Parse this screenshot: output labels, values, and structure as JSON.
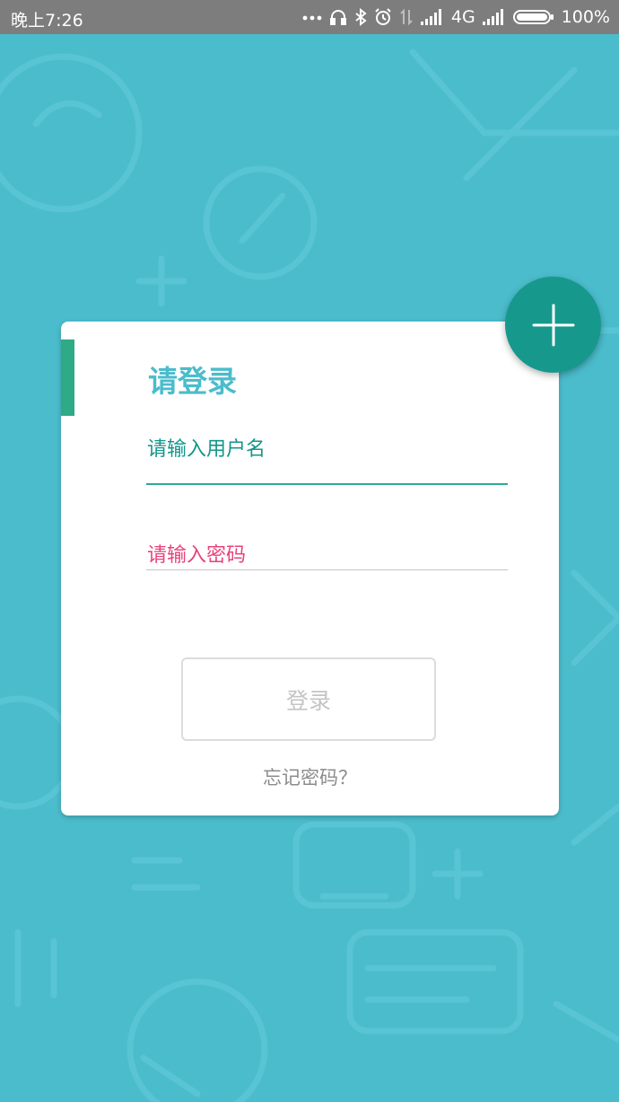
{
  "status_bar": {
    "time": "晚上7:26",
    "network": "4G",
    "battery": "100%",
    "icons": [
      "more-dots-icon",
      "headset-icon",
      "bluetooth-icon",
      "alarm-icon",
      "data-arrows-icon",
      "signal-icon",
      "battery-icon"
    ]
  },
  "login": {
    "title": "请登录",
    "username_label": "请输入用户名",
    "password_label": "请输入密码",
    "login_button": "登录",
    "forgot_password": "忘记密码？"
  },
  "fab": {
    "icon": "plus-icon"
  },
  "colors": {
    "background": "#4bbccc",
    "accent_green": "#2eaa86",
    "fab": "#16998c",
    "title": "#4bbccc",
    "username_label": "#13958a",
    "password_label": "#e8437b",
    "status_bar": "#7d7d7d"
  }
}
